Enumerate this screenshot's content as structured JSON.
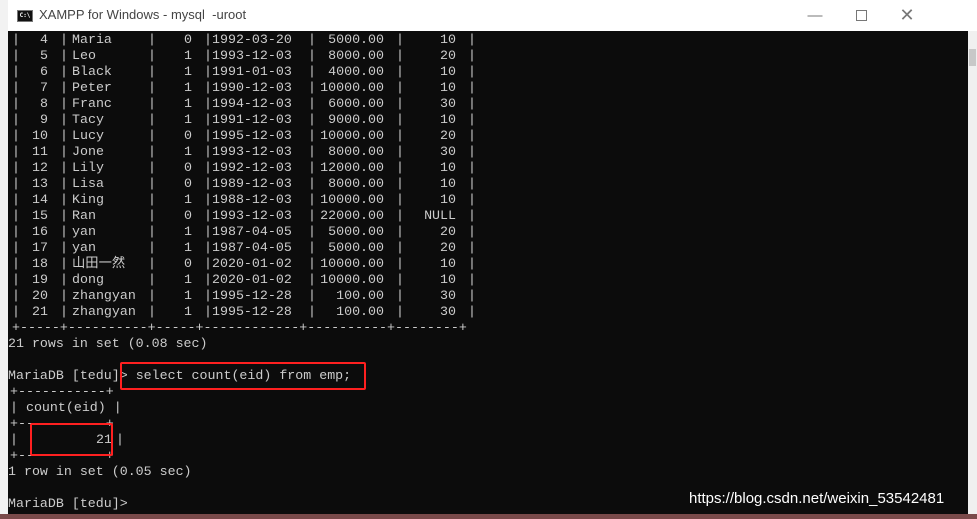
{
  "window": {
    "title": "XAMPP for Windows - mysql  -uroot",
    "icon": "console-icon",
    "controls": [
      "minimize-icon",
      "maximize-icon",
      "close-icon"
    ]
  },
  "table": {
    "rows": [
      [
        "4",
        "Maria",
        "0",
        "1992-03-20",
        "5000.00",
        "10"
      ],
      [
        "5",
        "Leo",
        "1",
        "1993-12-03",
        "8000.00",
        "20"
      ],
      [
        "6",
        "Black",
        "1",
        "1991-01-03",
        "4000.00",
        "10"
      ],
      [
        "7",
        "Peter",
        "1",
        "1990-12-03",
        "10000.00",
        "10"
      ],
      [
        "8",
        "Franc",
        "1",
        "1994-12-03",
        "6000.00",
        "30"
      ],
      [
        "9",
        "Tacy",
        "1",
        "1991-12-03",
        "9000.00",
        "10"
      ],
      [
        "10",
        "Lucy",
        "0",
        "1995-12-03",
        "10000.00",
        "20"
      ],
      [
        "11",
        "Jone",
        "1",
        "1993-12-03",
        "8000.00",
        "30"
      ],
      [
        "12",
        "Lily",
        "0",
        "1992-12-03",
        "12000.00",
        "10"
      ],
      [
        "13",
        "Lisa",
        "0",
        "1989-12-03",
        "8000.00",
        "10"
      ],
      [
        "14",
        "King",
        "1",
        "1988-12-03",
        "10000.00",
        "10"
      ],
      [
        "15",
        "Ran",
        "0",
        "1993-12-03",
        "22000.00",
        "NULL"
      ],
      [
        "16",
        "yan",
        "1",
        "1987-04-05",
        "5000.00",
        "20"
      ],
      [
        "17",
        "yan",
        "1",
        "1987-04-05",
        "5000.00",
        "20"
      ],
      [
        "18",
        "山田一然",
        "0",
        "2020-01-02",
        "10000.00",
        "10"
      ],
      [
        "19",
        "dong",
        "1",
        "2020-01-02",
        "10000.00",
        "10"
      ],
      [
        "20",
        "zhangyan",
        "1",
        "1995-12-28",
        "100.00",
        "30"
      ],
      [
        "21",
        "zhangyan",
        "1",
        "1995-12-28",
        "100.00",
        "30"
      ]
    ],
    "border": "-----+----------+-----+------------+----------+--------+",
    "summary": "21 rows in set (0.08 sec)"
  },
  "query": {
    "prompt": "MariaDB [tedu]>",
    "command": "select count(eid) from emp;",
    "result_border": "+-----------+",
    "result_header": "| count(eid) |",
    "result_value_line": "|        21 |",
    "result_value": "21",
    "summary": "1 row in set (0.05 sec)"
  },
  "final_prompt": "MariaDB [tedu]>",
  "watermark": "https://blog.csdn.net/weixin_53542481",
  "colors": {
    "terminal_bg": "#0c0c0c",
    "terminal_fg": "#cccccc",
    "highlight": "#ff2020"
  }
}
